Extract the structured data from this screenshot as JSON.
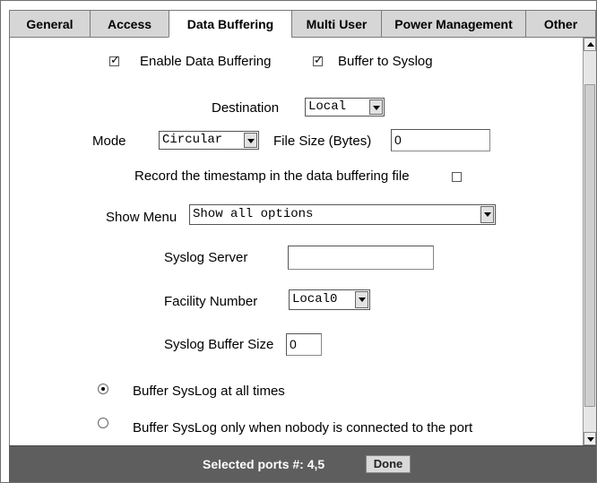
{
  "tabs": [
    "General",
    "Access",
    "Data Buffering",
    "Multi User",
    "Power Management",
    "Other"
  ],
  "active_tab": "Data Buffering",
  "form": {
    "enable_data_buffering": {
      "label": "Enable Data Buffering",
      "checked": true
    },
    "buffer_to_syslog": {
      "label": "Buffer to Syslog",
      "checked": true
    },
    "destination": {
      "label": "Destination",
      "value": "Local"
    },
    "mode": {
      "label": "Mode",
      "value": "Circular"
    },
    "file_size": {
      "label": "File Size (Bytes)",
      "value": "0"
    },
    "record_timestamp": {
      "label": "Record the timestamp in the data buffering file",
      "checked": false
    },
    "show_menu": {
      "label": "Show Menu",
      "value": "Show all options"
    },
    "syslog_server": {
      "label": "Syslog Server",
      "value": ""
    },
    "facility_number": {
      "label": "Facility Number",
      "value": "Local0"
    },
    "syslog_buffer_size": {
      "label": "Syslog Buffer Size",
      "value": "0"
    },
    "buffer_syslog_options": [
      {
        "label": "Buffer SysLog at all times",
        "selected": true
      },
      {
        "label": "Buffer SysLog only when nobody is connected to the port",
        "selected": false
      }
    ]
  },
  "footer": {
    "selected_ports": "Selected ports #: 4,5",
    "done_label": "Done"
  }
}
